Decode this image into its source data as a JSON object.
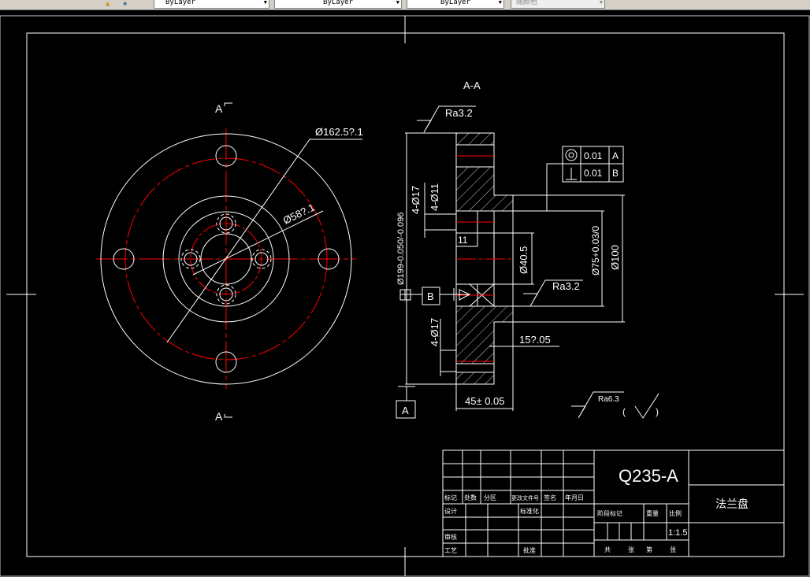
{
  "toolbar": {
    "linetype": "ByLayer",
    "lineweight": "ByLayer",
    "plotstyle": "ByLayer",
    "color": "随颜色",
    "icons": [
      "layer-state-icon",
      "layer-previous-icon"
    ]
  },
  "colors": {
    "background": "#000000",
    "lines": "#ffffff",
    "centerlines": "#ff0000"
  },
  "drawing": {
    "section_label_top": "A",
    "section_label_bottom": "A",
    "section_view_title": "A-A",
    "dims": {
      "outer_dia": "Ø162.5?.1",
      "bolt_dia": "Ø58?.1",
      "d199": "Ø199-0.050/-0.096",
      "holes_17_top": "4-Ø17",
      "holes_11": "4-Ø11",
      "depth11": "11",
      "d40": "Ø40.5",
      "d75": "Ø75+0.03/0",
      "d100": "Ø100",
      "d15": "15?.05",
      "thick45": "45± 0.05",
      "ra_top": "Ra3.2",
      "ra_mid": "Ra3.2",
      "ra_general": "Ra6.3",
      "ra_paren_open": "(",
      "ra_paren_close": ")",
      "holes_17_bot": "4-Ø17"
    },
    "tolerance_frame": [
      {
        "symbol": "concentricity",
        "value": "0.01",
        "datum": "A"
      },
      {
        "symbol": "perpendicularity",
        "value": "0.01",
        "datum": "B"
      }
    ],
    "datum_a": "A",
    "datum_b": "B"
  },
  "title_block": {
    "material": "Q235-A",
    "part_name": "法兰盘",
    "scale": "1:1.5",
    "rev_headers": [
      "标记",
      "处数",
      "分区",
      "更改文件号",
      "签名",
      "年月日"
    ],
    "design": "设计",
    "standard": "标准化",
    "review": "审核",
    "process": "工艺",
    "approve": "批准",
    "stage_mark": "阶段标记",
    "weight": "重量",
    "scale_label": "比例",
    "sheets": [
      "共",
      "张",
      "第",
      "张"
    ]
  }
}
